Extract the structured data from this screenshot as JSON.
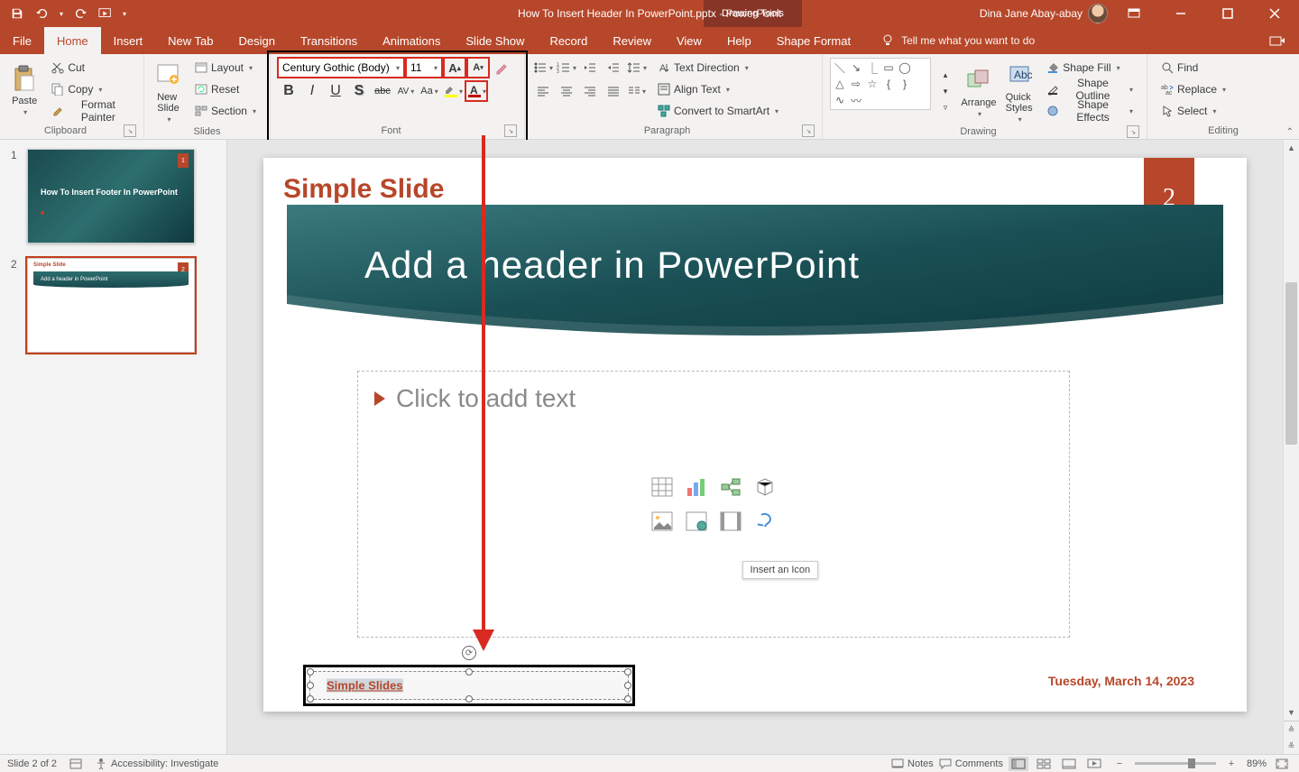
{
  "titlebar": {
    "doc_title": "How To Insert Header In PowerPoint.pptx",
    "app_suffix": "  -  PowerPoint",
    "context_tab_group": "Drawing Tools",
    "user_name": "Dina Jane Abay-abay"
  },
  "tabs": {
    "file": "File",
    "home": "Home",
    "insert": "Insert",
    "newtab": "New Tab",
    "design": "Design",
    "transitions": "Transitions",
    "animations": "Animations",
    "slideshow": "Slide Show",
    "record": "Record",
    "review": "Review",
    "view": "View",
    "help": "Help",
    "shapeformat": "Shape Format",
    "tellme": "Tell me what you want to do"
  },
  "ribbon": {
    "clipboard": {
      "label": "Clipboard",
      "paste": "Paste",
      "cut": "Cut",
      "copy": "Copy",
      "format_painter": "Format Painter"
    },
    "slides": {
      "label": "Slides",
      "new_slide": "New\nSlide",
      "layout": "Layout",
      "reset": "Reset",
      "section": "Section"
    },
    "font": {
      "label": "Font",
      "font_name": "Century Gothic (Body)",
      "font_size": "11"
    },
    "paragraph": {
      "label": "Paragraph",
      "text_direction": "Text Direction",
      "align_text": "Align Text",
      "convert_smartart": "Convert to SmartArt"
    },
    "drawing": {
      "label": "Drawing",
      "arrange": "Arrange",
      "quick_styles": "Quick\nStyles",
      "shape_fill": "Shape Fill",
      "shape_outline": "Shape Outline",
      "shape_effects": "Shape Effects"
    },
    "editing": {
      "label": "Editing",
      "find": "Find",
      "replace": "Replace",
      "select": "Select"
    }
  },
  "thumbnails": {
    "s1": {
      "num": "1",
      "badge": "1",
      "title": "How To Insert Footer In PowerPoint"
    },
    "s2": {
      "num": "2",
      "badge": "2",
      "label": "Simple Slide",
      "header": "Add a header in PowerPoint"
    }
  },
  "slide": {
    "simple_label": "Simple Slide",
    "page_num": "2",
    "header_title": "Add a header in PowerPoint",
    "placeholder": "Click to add text",
    "icon_tooltip": "Insert an Icon",
    "date": "Tuesday, March 14, 2023",
    "footer_text": "Simple Slides"
  },
  "status": {
    "slide_pos": "Slide 2 of 2",
    "accessibility": "Accessibility: Investigate",
    "notes": "Notes",
    "comments": "Comments",
    "zoom": "89%"
  }
}
